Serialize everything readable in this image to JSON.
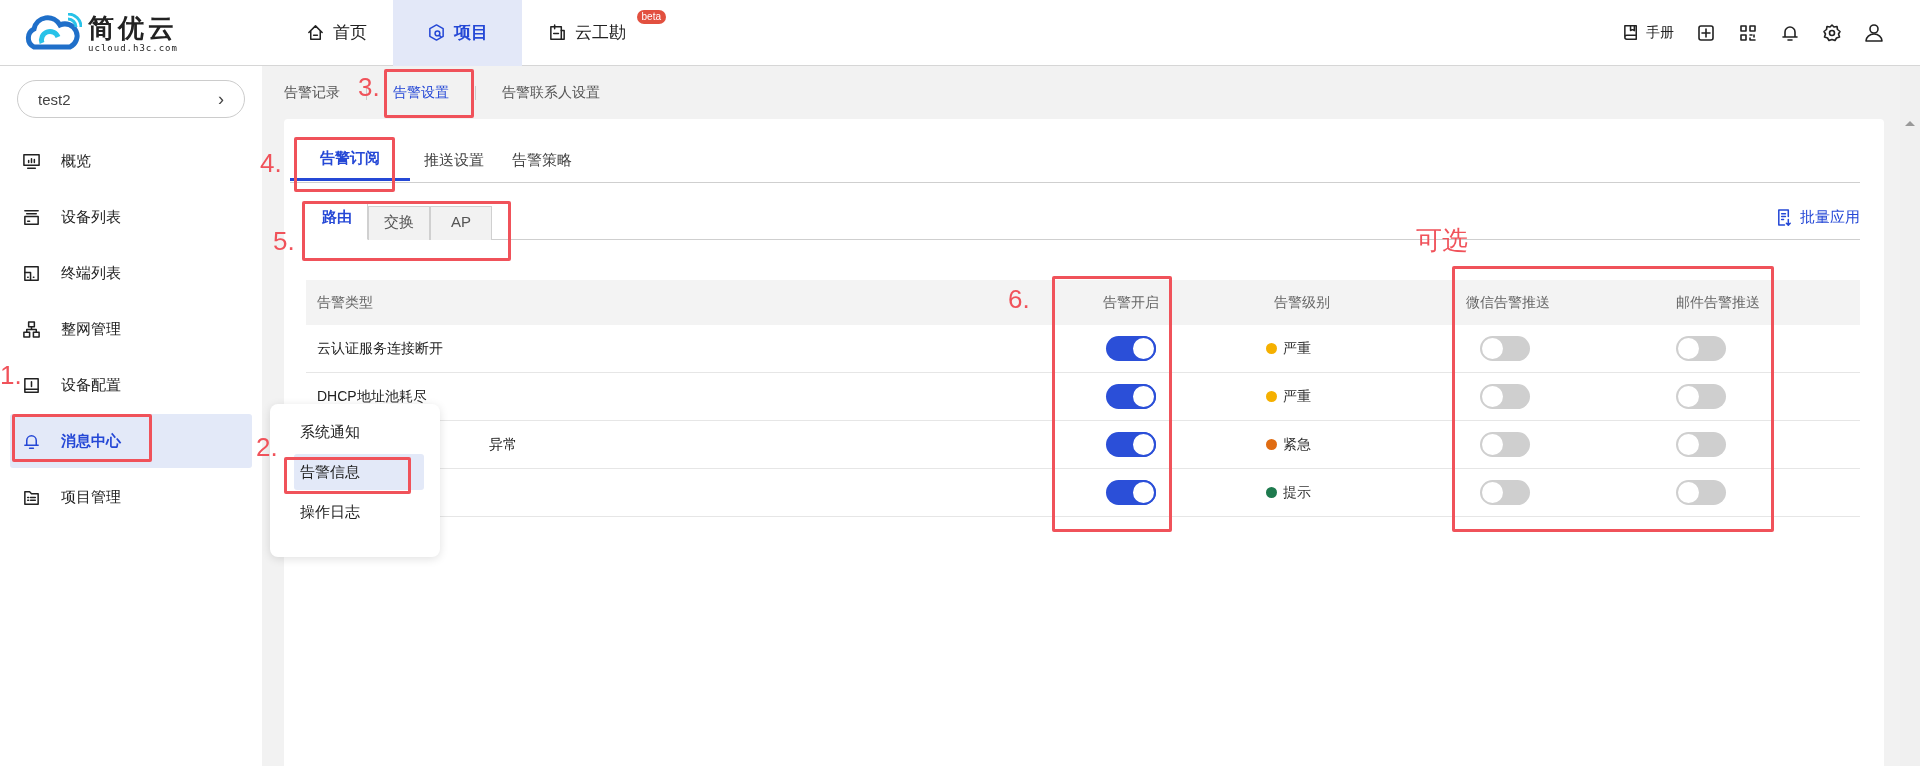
{
  "header": {
    "logo_text": "简优云",
    "logo_subtext": "ucloud.h3c.com",
    "nav": [
      {
        "label": "首页",
        "selected": false
      },
      {
        "label": "项目",
        "selected": true
      },
      {
        "label": "云工勘",
        "selected": false,
        "badge": "beta"
      }
    ],
    "manual": "手册"
  },
  "sidebar": {
    "project": "test2",
    "project_arrow": "›",
    "items": [
      {
        "label": "概览",
        "selected": false
      },
      {
        "label": "设备列表",
        "selected": false
      },
      {
        "label": "终端列表",
        "selected": false
      },
      {
        "label": "整网管理",
        "selected": false
      },
      {
        "label": "设备配置",
        "selected": false
      },
      {
        "label": "消息中心",
        "selected": true
      },
      {
        "label": "项目管理",
        "selected": false
      }
    ]
  },
  "popup_menu": [
    {
      "label": "系统通知",
      "selected": false
    },
    {
      "label": "告警信息",
      "selected": true
    },
    {
      "label": "操作日志",
      "selected": false
    }
  ],
  "page_tabs": [
    {
      "label": "告警记录",
      "selected": false
    },
    {
      "label": "告警设置",
      "selected": true
    },
    {
      "label": "告警联系人设置",
      "selected": false
    }
  ],
  "tabs": [
    {
      "label": "告警订阅",
      "selected": true
    },
    {
      "label": "推送设置",
      "selected": false
    },
    {
      "label": "告警策略",
      "selected": false
    }
  ],
  "device_tabs": [
    {
      "label": "路由",
      "selected": true
    },
    {
      "label": "交换",
      "selected": false
    },
    {
      "label": "AP",
      "selected": false
    }
  ],
  "batch_apply": "批量应用",
  "table": {
    "columns": [
      "告警类型",
      "告警开启",
      "告警级别",
      "微信告警推送",
      "邮件告警推送"
    ],
    "rows": [
      {
        "kind": "plain",
        "type": "云认证服务连接断开",
        "enabled": true,
        "level": "严重",
        "color": "#f5b000",
        "wechat": false,
        "email": false
      },
      {
        "kind": "plain",
        "type": "DHCP地址池耗尽",
        "enabled": true,
        "level": "严重",
        "color": "#f5b000",
        "wechat": false,
        "email": false
      },
      {
        "kind": "covered",
        "type": "异常",
        "enabled": true,
        "level": "紧急",
        "color": "#e06c12",
        "wechat": false,
        "email": false
      },
      {
        "enabled": true,
        "level": "提示",
        "color": "#1e7a4e",
        "wechat": false,
        "email": false
      }
    ]
  },
  "annotations": [
    {
      "label": "1."
    },
    {
      "label": "2."
    },
    {
      "label": "3."
    },
    {
      "label": "4."
    },
    {
      "label": "5."
    },
    {
      "label": "6."
    },
    {
      "label": "可选"
    }
  ]
}
